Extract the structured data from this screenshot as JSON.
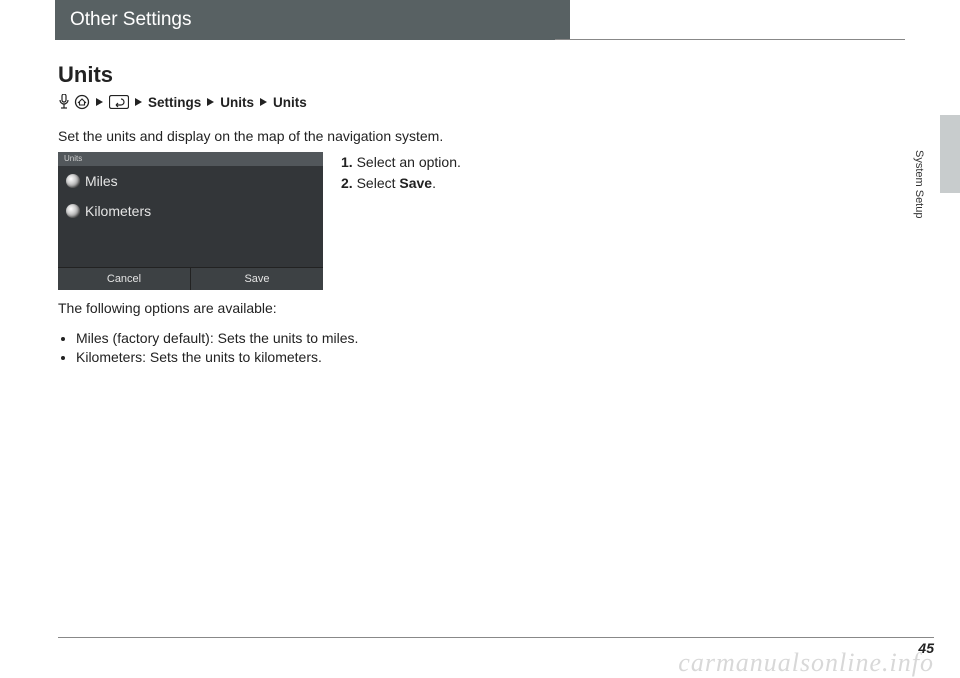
{
  "header": {
    "title": "Other Settings"
  },
  "section": {
    "heading": "Units",
    "breadcrumb": {
      "item1": "Settings",
      "item2": "Units",
      "item3": "Units"
    },
    "description": "Set the units and display on the map of the navigation system.",
    "screenshot": {
      "title": "Units",
      "options": [
        "Miles",
        "Kilometers"
      ],
      "buttons": {
        "cancel": "Cancel",
        "save": "Save"
      }
    },
    "steps": [
      {
        "num": "1.",
        "text": "Select an option."
      },
      {
        "num": "2.",
        "text_pre": "Select ",
        "bold": "Save",
        "text_post": "."
      }
    ],
    "options_intro": "The following options are available:",
    "options": [
      {
        "name": "Miles",
        "note": " (factory default): Sets the units to miles."
      },
      {
        "name": "Kilometers",
        "note": ": Sets the units to kilometers."
      }
    ]
  },
  "side_label": "System Setup",
  "page_number": "45",
  "watermark": "carmanualsonline.info"
}
